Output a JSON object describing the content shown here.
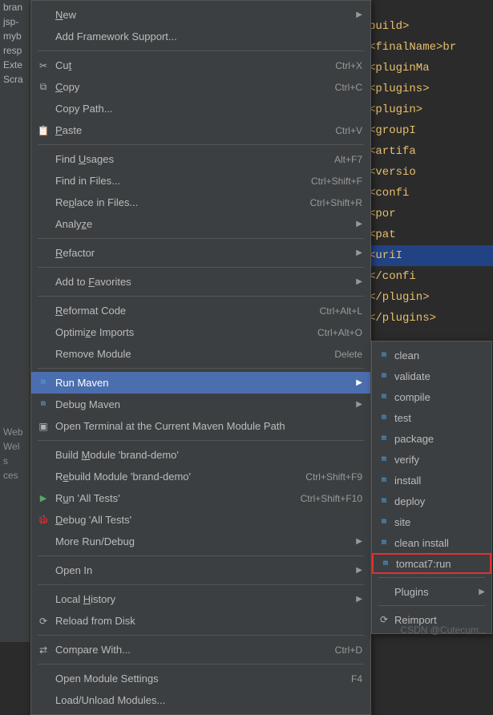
{
  "tree": [
    "bran",
    "jsp-",
    "myb",
    "resp",
    "Exte",
    "Scra"
  ],
  "bottom_tabs": [
    "Web",
    "Wel",
    "s",
    "ces"
  ],
  "editor_lines": [
    "build>",
    "<finalName>br",
    "    <pluginMa",
    "  <plugins>",
    "    <plugin>",
    "        <groupI",
    "        <artifa",
    "        <versio",
    "        <confi",
    "            <por",
    "            <pat",
    "            <uriI",
    "        </confi",
    "    </plugin>",
    "  </plugins>"
  ],
  "menu": [
    {
      "icon": "",
      "label": "New",
      "u": "N",
      "shortcut": "",
      "arrow": true
    },
    {
      "icon": "",
      "label": "Add Framework Support...",
      "shortcut": ""
    },
    "sep",
    {
      "icon": "cut",
      "label": "Cut",
      "u": "t",
      "shortcut": "Ctrl+X"
    },
    {
      "icon": "copy",
      "label": "Copy",
      "u": "C",
      "shortcut": "Ctrl+C"
    },
    {
      "icon": "",
      "label": "Copy Path...",
      "shortcut": ""
    },
    {
      "icon": "paste",
      "label": "Paste",
      "u": "P",
      "shortcut": "Ctrl+V"
    },
    "sep",
    {
      "icon": "",
      "label": "Find Usages",
      "u": "U",
      "shortcut": "Alt+F7"
    },
    {
      "icon": "",
      "label": "Find in Files...",
      "shortcut": "Ctrl+Shift+F"
    },
    {
      "icon": "",
      "label": "Replace in Files...",
      "u": "p",
      "shortcut": "Ctrl+Shift+R"
    },
    {
      "icon": "",
      "label": "Analyze",
      "u": "z",
      "shortcut": "",
      "arrow": true
    },
    "sep",
    {
      "icon": "",
      "label": "Refactor",
      "u": "R",
      "shortcut": "",
      "arrow": true
    },
    "sep",
    {
      "icon": "",
      "label": "Add to Favorites",
      "u": "F",
      "shortcut": "",
      "arrow": true
    },
    "sep",
    {
      "icon": "",
      "label": "Reformat Code",
      "u": "R",
      "shortcut": "Ctrl+Alt+L"
    },
    {
      "icon": "",
      "label": "Optimize Imports",
      "u": "z",
      "shortcut": "Ctrl+Alt+O"
    },
    {
      "icon": "",
      "label": "Remove Module",
      "shortcut": "Delete"
    },
    "sep",
    {
      "icon": "maven",
      "label": "Run Maven",
      "shortcut": "",
      "arrow": true,
      "selected": true
    },
    {
      "icon": "maven",
      "label": "Debug Maven",
      "shortcut": "",
      "arrow": true
    },
    {
      "icon": "term",
      "label": "Open Terminal at the Current Maven Module Path",
      "shortcut": ""
    },
    "sep",
    {
      "icon": "",
      "label": "Build Module 'brand-demo'",
      "u": "M",
      "shortcut": ""
    },
    {
      "icon": "",
      "label": "Rebuild Module 'brand-demo'",
      "u": "e",
      "shortcut": "Ctrl+Shift+F9"
    },
    {
      "icon": "run",
      "label": "Run 'All Tests'",
      "u": "u",
      "shortcut": "Ctrl+Shift+F10"
    },
    {
      "icon": "debug",
      "label": "Debug 'All Tests'",
      "u": "D",
      "shortcut": ""
    },
    {
      "icon": "",
      "label": "More Run/Debug",
      "shortcut": "",
      "arrow": true
    },
    "sep",
    {
      "icon": "",
      "label": "Open In",
      "shortcut": "",
      "arrow": true
    },
    "sep",
    {
      "icon": "",
      "label": "Local History",
      "u": "H",
      "shortcut": "",
      "arrow": true
    },
    {
      "icon": "reload",
      "label": "Reload from Disk",
      "shortcut": ""
    },
    "sep",
    {
      "icon": "compare",
      "label": "Compare With...",
      "shortcut": "Ctrl+D"
    },
    "sep",
    {
      "icon": "",
      "label": "Open Module Settings",
      "shortcut": "F4"
    },
    {
      "icon": "",
      "label": "Load/Unload Modules...",
      "shortcut": ""
    }
  ],
  "submenu": {
    "goals": [
      "clean",
      "validate",
      "compile",
      "test",
      "package",
      "verify",
      "install",
      "deploy",
      "site",
      "clean install"
    ],
    "highlighted": "tomcat7:run",
    "plugins_label": "Plugins",
    "reimport_label": "Reimport"
  },
  "watermark": "CSDN @Cutecum..."
}
